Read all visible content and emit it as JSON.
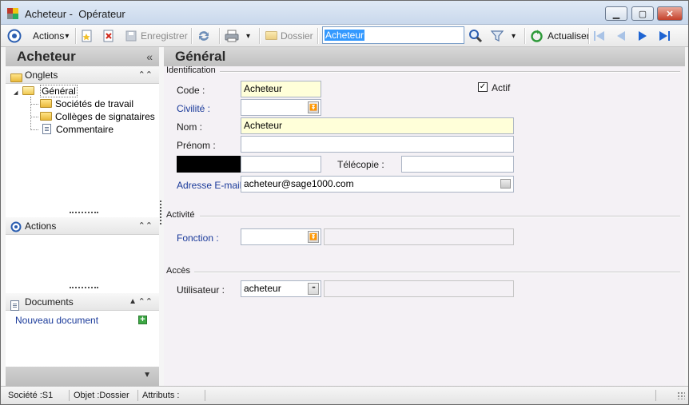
{
  "window": {
    "title": "Acheteur -  Opérateur",
    "minimize_glyph": "▁",
    "maximize_glyph": "▢",
    "close_glyph": "✕"
  },
  "toolbar": {
    "actions_label": "Actions",
    "actions_arrow": "▾",
    "save_label": "Enregistrer",
    "print_arrow": "▾",
    "folder_label": "Dossier",
    "search_value": "Acheteur",
    "filter_arrow": "▾",
    "refresh_label": "Actualiser"
  },
  "left_panel": {
    "title": "Acheteur",
    "collapse_glyph": "«",
    "onglets_label": "Onglets",
    "tree_root_expander": "◢",
    "tree_root": "Général",
    "tree_children": [
      "Sociétés de travail",
      "Collèges de signataires",
      "Commentaire"
    ],
    "actions_label": "Actions",
    "documents_label": "Documents",
    "new_document_label": "Nouveau document",
    "section_toggle_glyph": "⌃⌃",
    "documents_up_glyph": "▲",
    "footer_glyph": "▼"
  },
  "main": {
    "title": "Général",
    "identification_label": "Identification",
    "code_label": "Code :",
    "code_value": "Acheteur",
    "actif_label": "Actif",
    "actif_checked": true,
    "civilite_label": "Civilité :",
    "civilite_value": "",
    "nom_label": "Nom :",
    "nom_value": "Acheteur",
    "prenom_label": "Prénom :",
    "prenom_value": "",
    "telephone_value": "",
    "telecopie_label": "Télécopie :",
    "telecopie_value": "",
    "email_label": "Adresse E-mail :",
    "email_value": "acheteur@sage1000.com",
    "activite_label": "Activité",
    "fonction_label": "Fonction :",
    "fonction_value": "",
    "fonction_desc": "",
    "acces_label": "Accès",
    "utilisateur_label": "Utilisateur :",
    "utilisateur_value": "acheteur",
    "utilisateur_desc": "",
    "dropdown_glyph": "⏬",
    "ellipsis_glyph": "•••"
  },
  "statusbar": {
    "societe": "Société :S1",
    "objet": "Objet :Dossier",
    "attributs": "Attributs :",
    "empty1": "",
    "empty2": ""
  }
}
